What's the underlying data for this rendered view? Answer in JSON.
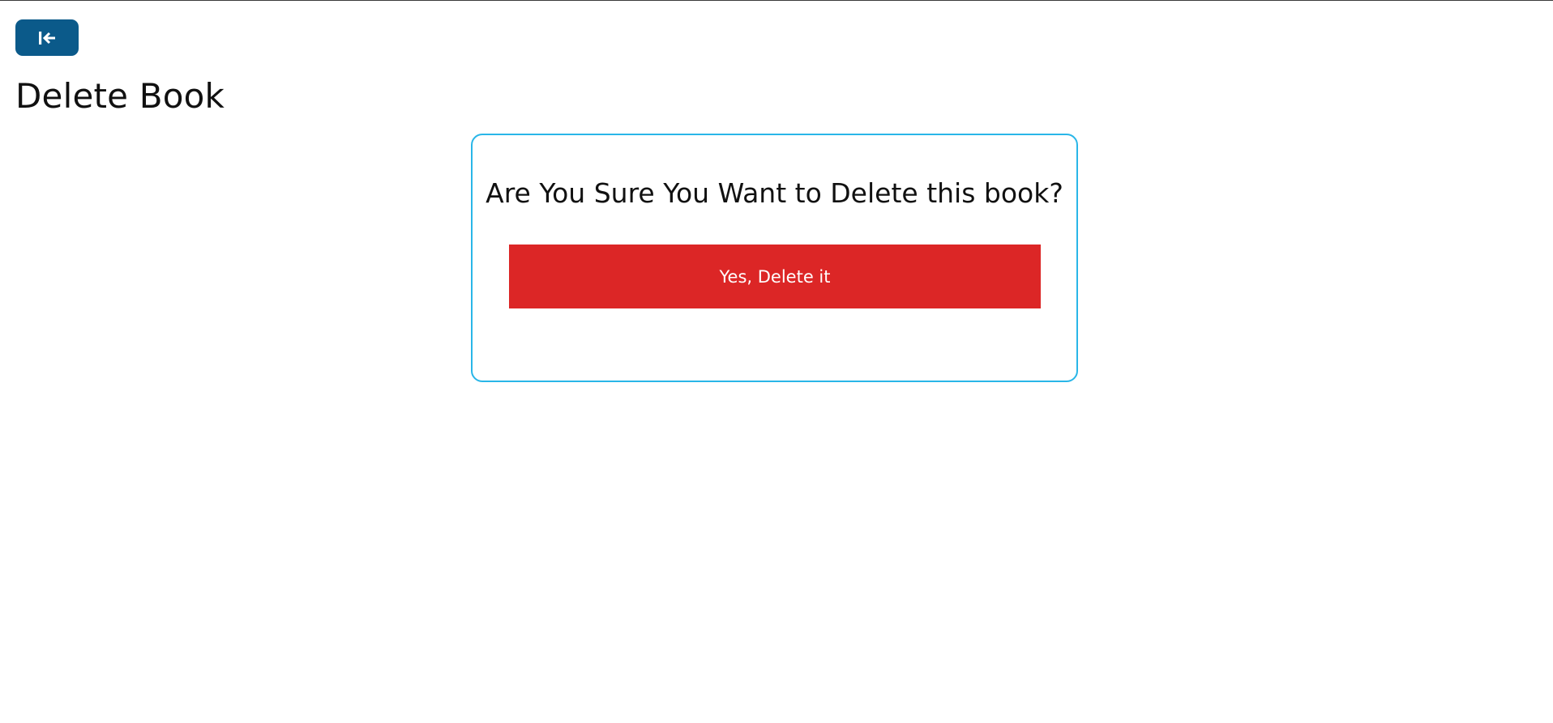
{
  "header": {
    "back_button": {
      "icon": "arrow-left-to-line-icon",
      "background": "#0b5a8a"
    },
    "page_title": "Delete Book"
  },
  "confirm_card": {
    "border_color": "#29b6e8",
    "question": "Are You Sure You Want to Delete this book?",
    "delete_button": {
      "label": "Yes, Delete it",
      "background": "#dc2626"
    }
  }
}
